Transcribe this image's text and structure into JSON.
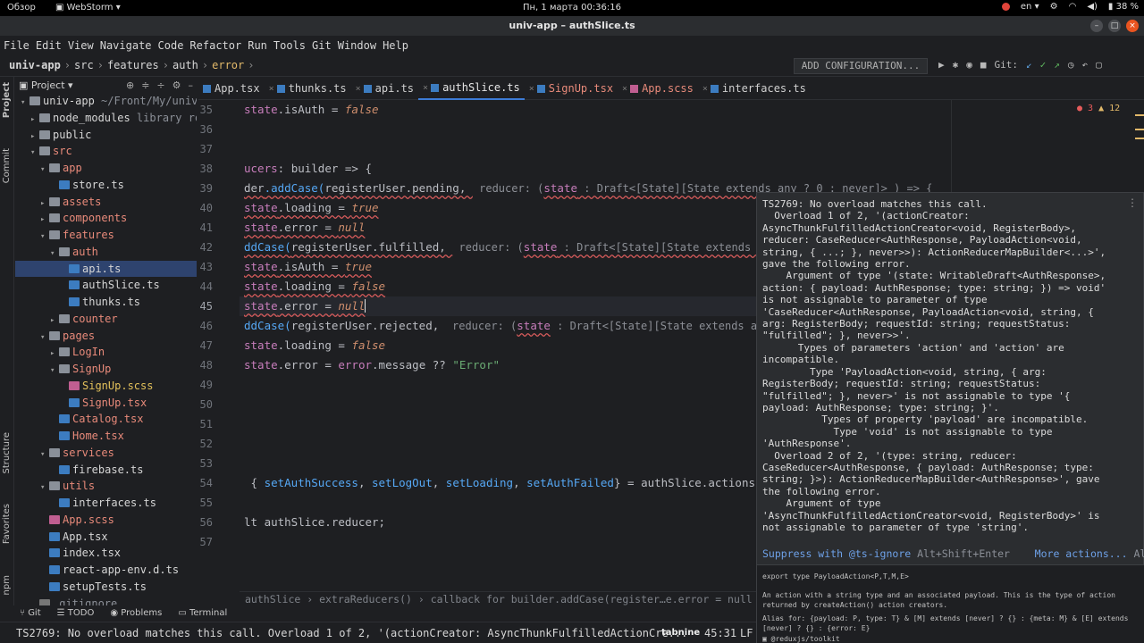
{
  "system_bar": {
    "activities": "Обзор",
    "app_menu": "WebStorm",
    "clock": "Пн, 1 марта  00:36:16",
    "lang": "en",
    "battery": "38 %"
  },
  "window": {
    "title": "univ-app – authSlice.ts"
  },
  "menu": [
    "File",
    "Edit",
    "View",
    "Navigate",
    "Code",
    "Refactor",
    "Run",
    "Tools",
    "Git",
    "Window",
    "Help"
  ],
  "breadcrumbs": [
    "univ-app",
    "src",
    "features",
    "auth",
    "error"
  ],
  "toolbar": {
    "add_config": "ADD CONFIGURATION...",
    "git_label": "Git:"
  },
  "project_panel": {
    "title": "Project",
    "tree": [
      {
        "label": "univ-app",
        "extra": " ~/Front/My/univ-a",
        "depth": 0,
        "arrow": "▾",
        "icon": "folder",
        "color": "def"
      },
      {
        "label": "node_modules",
        "extra": "  library root",
        "depth": 1,
        "arrow": "▸",
        "icon": "folder",
        "color": "def"
      },
      {
        "label": "public",
        "extra": "",
        "depth": 1,
        "arrow": "▸",
        "icon": "folder",
        "color": "def"
      },
      {
        "label": "src",
        "extra": "",
        "depth": 1,
        "arrow": "▾",
        "icon": "folder",
        "color": "red"
      },
      {
        "label": "app",
        "extra": "",
        "depth": 2,
        "arrow": "▾",
        "icon": "folder",
        "color": "red"
      },
      {
        "label": "store.ts",
        "extra": "",
        "depth": 3,
        "arrow": "",
        "icon": "ts",
        "color": "def"
      },
      {
        "label": "assets",
        "extra": "",
        "depth": 2,
        "arrow": "▸",
        "icon": "folder",
        "color": "red"
      },
      {
        "label": "components",
        "extra": "",
        "depth": 2,
        "arrow": "▸",
        "icon": "folder",
        "color": "red"
      },
      {
        "label": "features",
        "extra": "",
        "depth": 2,
        "arrow": "▾",
        "icon": "folder",
        "color": "red"
      },
      {
        "label": "auth",
        "extra": "",
        "depth": 3,
        "arrow": "▾",
        "icon": "folder",
        "color": "red"
      },
      {
        "label": "api.ts",
        "extra": "",
        "depth": 4,
        "arrow": "",
        "icon": "ts",
        "color": "def",
        "selected": true
      },
      {
        "label": "authSlice.ts",
        "extra": "",
        "depth": 4,
        "arrow": "",
        "icon": "ts",
        "color": "def"
      },
      {
        "label": "thunks.ts",
        "extra": "",
        "depth": 4,
        "arrow": "",
        "icon": "ts",
        "color": "def"
      },
      {
        "label": "counter",
        "extra": "",
        "depth": 3,
        "arrow": "▸",
        "icon": "folder",
        "color": "red"
      },
      {
        "label": "pages",
        "extra": "",
        "depth": 2,
        "arrow": "▾",
        "icon": "folder",
        "color": "red"
      },
      {
        "label": "LogIn",
        "extra": "",
        "depth": 3,
        "arrow": "▸",
        "icon": "folder",
        "color": "red"
      },
      {
        "label": "SignUp",
        "extra": "",
        "depth": 3,
        "arrow": "▾",
        "icon": "folder",
        "color": "red"
      },
      {
        "label": "SignUp.scss",
        "extra": "",
        "depth": 4,
        "arrow": "",
        "icon": "scss",
        "color": "yel"
      },
      {
        "label": "SignUp.tsx",
        "extra": "",
        "depth": 4,
        "arrow": "",
        "icon": "tsx",
        "color": "red"
      },
      {
        "label": "Catalog.tsx",
        "extra": "",
        "depth": 3,
        "arrow": "",
        "icon": "tsx",
        "color": "red"
      },
      {
        "label": "Home.tsx",
        "extra": "",
        "depth": 3,
        "arrow": "",
        "icon": "tsx",
        "color": "red"
      },
      {
        "label": "services",
        "extra": "",
        "depth": 2,
        "arrow": "▾",
        "icon": "folder",
        "color": "red"
      },
      {
        "label": "firebase.ts",
        "extra": "",
        "depth": 3,
        "arrow": "",
        "icon": "ts",
        "color": "def"
      },
      {
        "label": "utils",
        "extra": "",
        "depth": 2,
        "arrow": "▾",
        "icon": "folder",
        "color": "red"
      },
      {
        "label": "interfaces.ts",
        "extra": "",
        "depth": 3,
        "arrow": "",
        "icon": "ts",
        "color": "def"
      },
      {
        "label": "App.scss",
        "extra": "",
        "depth": 2,
        "arrow": "",
        "icon": "scss",
        "color": "red"
      },
      {
        "label": "App.tsx",
        "extra": "",
        "depth": 2,
        "arrow": "",
        "icon": "tsx",
        "color": "def"
      },
      {
        "label": "index.tsx",
        "extra": "",
        "depth": 2,
        "arrow": "",
        "icon": "tsx",
        "color": "def"
      },
      {
        "label": "react-app-env.d.ts",
        "extra": "",
        "depth": 2,
        "arrow": "",
        "icon": "ts",
        "color": "def"
      },
      {
        "label": "setupTests.ts",
        "extra": "",
        "depth": 2,
        "arrow": "",
        "icon": "ts",
        "color": "def"
      },
      {
        "label": ".gitignore",
        "extra": "",
        "depth": 1,
        "arrow": "",
        "icon": "file",
        "color": "gray"
      }
    ]
  },
  "side_labels": {
    "project": "Project",
    "commit": "Commit",
    "structure": "Structure",
    "favorites": "Favorites",
    "npm": "npm"
  },
  "tabs": [
    {
      "label": "App.tsx",
      "kind": "tsx",
      "red": false,
      "active": false
    },
    {
      "label": "thunks.ts",
      "kind": "ts",
      "red": false,
      "active": false
    },
    {
      "label": "api.ts",
      "kind": "ts",
      "red": false,
      "active": false
    },
    {
      "label": "authSlice.ts",
      "kind": "ts",
      "red": false,
      "active": true
    },
    {
      "label": "SignUp.tsx",
      "kind": "tsx",
      "red": true,
      "active": false
    },
    {
      "label": "App.scss",
      "kind": "scss",
      "red": true,
      "active": false
    },
    {
      "label": "interfaces.ts",
      "kind": "ts",
      "red": false,
      "active": false
    }
  ],
  "editor": {
    "line_numbers": [
      "35",
      "36",
      "37",
      "38",
      "39",
      "40",
      "41",
      "42",
      "43",
      "44",
      "45",
      "46",
      "47",
      "48",
      "49",
      "50",
      "51",
      "52",
      "53",
      "54",
      "55",
      "56",
      "57"
    ],
    "error_count": "3",
    "warning_count": "12",
    "current_line": "45",
    "code": {
      "l35a": "state",
      "l35b": ".isAuth = ",
      "l35c": "false",
      "l38a": "ucers",
      "l38b": ": builder => {",
      "l39a": "der",
      "l39b": ".addCase(",
      "l39c": "registerUser.pending, ",
      "l39d": " reducer: (",
      "l39e": "state",
      "l39f": " : Draft<[State][State extends any ? 0 : never]> ) => {",
      "l40a": "state",
      "l40b": ".loading = ",
      "l40c": "true",
      "l41a": "state",
      "l41b": ".error = ",
      "l41c": "null",
      "l42a": "ddCase(",
      "l42b": "registerUser.fulfilled, ",
      "l42c": " reducer: (",
      "l42d": "state",
      "l42e": " : Draft<[State][State extends any ? 0",
      "l43a": "state",
      "l43b": ".isAuth = ",
      "l43c": "true",
      "l44a": "state",
      "l44b": ".loading = ",
      "l44c": "false",
      "l45a": "state",
      "l45b": ".error = ",
      "l45c": "null",
      "l46a": "ddCase(",
      "l46b": "registerUser.rejected, ",
      "l46c": " reducer: (",
      "l46d": "state",
      "l46e": " : Draft<[State][State extends any ? 0",
      "l47a": "state",
      "l47b": ".loading = ",
      "l47c": "false",
      "l48a": "state",
      "l48b": ".error = ",
      "l48c": "error",
      "l48d": ".message ?? ",
      "l48e": "\"Error\"",
      "l54a": " { ",
      "l54b": "setAuthSuccess",
      "l54c": ", ",
      "l54d": "setLogOut",
      "l54e": ", ",
      "l54f": "setLoading",
      "l54g": ", ",
      "l54h": "setAuthFailed",
      "l54i": "} = authSlice.actions",
      "l56a": "lt authSlice.reducer;"
    }
  },
  "popup": {
    "text": "TS2769: No overload matches this call.\n  Overload 1 of 2, '(actionCreator:\nAsyncThunkFulfilledActionCreator<void, RegisterBody>,\nreducer: CaseReducer<AuthResponse, PayloadAction<void,\nstring, { ...; }, never>>): ActionReducerMapBuilder<...>',\ngave the following error.\n    Argument of type '(state: WritableDraft<AuthResponse>,\naction: { payload: AuthResponse; type: string; }) => void'\nis not assignable to parameter of type\n'CaseReducer<AuthResponse, PayloadAction<void, string, {\narg: RegisterBody; requestId: string; requestStatus:\n\"fulfilled\"; }, never>>'.\n      Types of parameters 'action' and 'action' are\nincompatible.\n        Type 'PayloadAction<void, string, { arg:\nRegisterBody; requestId: string; requestStatus:\n\"fulfilled\"; }, never>' is not assignable to type '{\npayload: AuthResponse; type: string; }'.\n          Types of property 'payload' are incompatible.\n            Type 'void' is not assignable to type\n'AuthResponse'.\n  Overload 2 of 2, '(type: string, reducer:\nCaseReducer<AuthResponse, { payload: AuthResponse; type:\nstring; }>): ActionReducerMapBuilder<AuthResponse>', gave\nthe following error.\n    Argument of type\n'AsyncThunkFulfilledActionCreator<void, RegisterBody>' is\nnot assignable to parameter of type 'string'.",
    "suppress_label": "Suppress with @ts-ignore",
    "suppress_key": "Alt+Shift+Enter",
    "more_label": "More actions...",
    "more_key": "Alt+Er"
  },
  "doc": {
    "signature": "export type PayloadAction<P,T,M,E>",
    "description": "An action with a string type and an associated payload. This is the type of action returned by createAction() action creators.",
    "alias": "Alias for: {payload: P, type: T} & [M] extends [never] ? {} : {meta: M} & [E] extends [never] ? {} : {error: E}",
    "module": "@reduxjs/toolkit"
  },
  "editor_breadcrumbs": "authSlice › extraReducers() › callback for builder.addCase(register…e.error = null }).a",
  "bottom_tools": [
    "Git",
    "TODO",
    "Problems",
    "Terminal"
  ],
  "status": {
    "message": "TS2769: No overload matches this call.  Overload 1 of 2, '(actionCreator: AsyncThunkFulfilledActionCre...",
    "plugin": "tabnine",
    "position": "45:31",
    "line_sep": "LF"
  }
}
